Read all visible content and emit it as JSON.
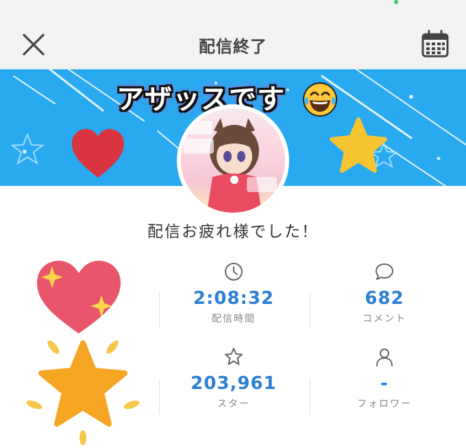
{
  "header": {
    "title": "配信終了",
    "close_icon": "close-icon",
    "calendar_icon": "calendar-icon"
  },
  "banner": {
    "caption": "アザッスです",
    "caption_emoji": "laughing-tears-emoji"
  },
  "main": {
    "greeting": "配信お疲れ様でした！"
  },
  "stats": {
    "duration": {
      "icon": "clock-icon",
      "value": "2:08:32",
      "label": "配信時間"
    },
    "comments": {
      "icon": "speech-bubble-icon",
      "value": "682",
      "label": "コメント"
    },
    "stars": {
      "icon": "star-icon",
      "value": "203,961",
      "label": "スター"
    },
    "followers": {
      "icon": "person-icon",
      "value": "-",
      "label": "フォロワー"
    }
  },
  "colors": {
    "banner": "#29a9f0",
    "accent_value": "#2d7fd3",
    "heart_red": "#d9343f",
    "heart_pink": "#e9566c",
    "star_yellow": "#f5c430",
    "star_orange": "#f6a623"
  }
}
